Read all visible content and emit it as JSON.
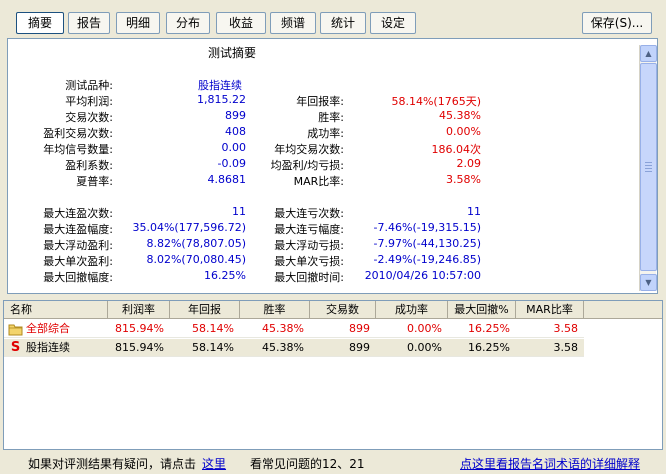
{
  "tabs": [
    {
      "label": "摘要",
      "active": true
    },
    {
      "label": "报告",
      "active": false
    },
    {
      "label": "明细",
      "active": false
    },
    {
      "label": "分布",
      "active": false
    },
    {
      "label": "收益",
      "active": false
    },
    {
      "label": "频谱",
      "active": false
    },
    {
      "label": "统计",
      "active": false
    },
    {
      "label": "设定",
      "active": false
    }
  ],
  "save_button": "保存(S)...",
  "summary": {
    "title": "测试摘要",
    "product_label": "测试品种:",
    "product_value": "股指连续",
    "rows": [
      {
        "l1": "平均利润:",
        "v1": "1,815.22",
        "l2": "年回报率:",
        "v2": "58.14%(1765天)"
      },
      {
        "l1": "交易次数:",
        "v1": "899",
        "l2": "胜率:",
        "v2": "45.38%"
      },
      {
        "l1": "盈利交易次数:",
        "v1": "408",
        "l2": "成功率:",
        "v2": "0.00%"
      },
      {
        "l1": "年均信号数量:",
        "v1": "0.00",
        "l2": "年均交易次数:",
        "v2": "186.04次"
      },
      {
        "l1": "盈利系数:",
        "v1": "-0.09",
        "l2": "均盈利/均亏损:",
        "v2": "2.09"
      },
      {
        "l1": "夏普率:",
        "v1": "4.8681",
        "l2": "MAR比率:",
        "v2": "3.58%"
      }
    ],
    "rows2": [
      {
        "l1": "最大连盈次数:",
        "v1": "11",
        "l2": "最大连亏次数:",
        "v2": "11"
      },
      {
        "l1": "最大连盈幅度:",
        "v1": "35.04%(177,596.72)",
        "l2": "最大连亏幅度:",
        "v2": "-7.46%(-19,315.15)"
      },
      {
        "l1": "最大浮动盈利:",
        "v1": "8.82%(78,807.05)",
        "l2": "最大浮动亏损:",
        "v2": "-7.97%(-44,130.25)"
      },
      {
        "l1": "最大单次盈利:",
        "v1": "8.02%(70,080.45)",
        "l2": "最大单次亏损:",
        "v2": "-2.49%(-19,246.85)"
      },
      {
        "l1": "最大回撤幅度:",
        "v1": "16.25%",
        "l2": "最大回撤时间:",
        "v2": "2010/04/26 10:57:00"
      }
    ]
  },
  "grid": {
    "headers": [
      "名称",
      "利润率",
      "年回报",
      "胜率",
      "交易数",
      "成功率",
      "最大回撤%",
      "MAR比率"
    ],
    "rows": [
      {
        "icon": "folder-icon",
        "cells": [
          "全部综合",
          "815.94%",
          "58.14%",
          "45.38%",
          "899",
          "0.00%",
          "16.25%",
          "3.58"
        ],
        "red": true
      },
      {
        "icon": "s-icon",
        "cells": [
          "股指连续",
          "815.94%",
          "58.14%",
          "45.38%",
          "899",
          "0.00%",
          "16.25%",
          "3.58"
        ],
        "red": false
      }
    ]
  },
  "status": {
    "text": "如果对评测结果有疑问，请点击",
    "link": "这里",
    "faq": "看常见问题的12、21",
    "terms": "点这里看报告名词术语的详细解释"
  }
}
